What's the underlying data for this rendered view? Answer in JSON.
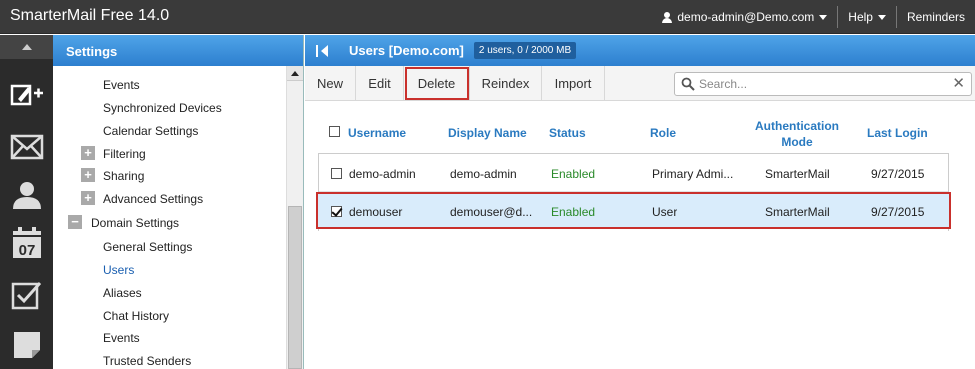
{
  "app": {
    "title": "SmarterMail Free 14.0"
  },
  "topbar": {
    "user": "demo-admin@Demo.com",
    "help": "Help",
    "reminders": "Reminders"
  },
  "rail": {
    "icons": [
      "compose-icon",
      "mail-icon",
      "contacts-icon",
      "calendar-icon",
      "tasks-icon",
      "notes-icon"
    ],
    "calendar_day": "07"
  },
  "settings": {
    "title": "Settings",
    "tree": [
      {
        "label": "Events",
        "indent": 2
      },
      {
        "label": "Synchronized Devices",
        "indent": 2
      },
      {
        "label": "Calendar Settings",
        "indent": 2
      },
      {
        "label": "Filtering",
        "indent": 1,
        "toggle": "+"
      },
      {
        "label": "Sharing",
        "indent": 1,
        "toggle": "+"
      },
      {
        "label": "Advanced Settings",
        "indent": 1,
        "toggle": "+"
      },
      {
        "label": "Domain Settings",
        "indent": 0,
        "toggle": "−"
      },
      {
        "label": "General Settings",
        "indent": 2
      },
      {
        "label": "Users",
        "indent": 2,
        "selected": true
      },
      {
        "label": "Aliases",
        "indent": 2
      },
      {
        "label": "Chat History",
        "indent": 2
      },
      {
        "label": "Events",
        "indent": 2
      },
      {
        "label": "Trusted Senders",
        "indent": 2
      }
    ]
  },
  "main": {
    "title": "Users [Demo.com]",
    "badge": "2 users, 0 / 2000 MB",
    "toolbar": {
      "new": "New",
      "edit": "Edit",
      "delete": "Delete",
      "reindex": "Reindex",
      "import": "Import"
    },
    "search": {
      "placeholder": "Search...",
      "value": ""
    },
    "columns": {
      "username": "Username",
      "display_name": "Display Name",
      "status": "Status",
      "role": "Role",
      "auth_mode_1": "Authentication",
      "auth_mode_2": "Mode",
      "last_login": "Last Login"
    },
    "rows": [
      {
        "username": "demo-admin",
        "display_name": "demo-admin",
        "status": "Enabled",
        "role": "Primary Admi...",
        "auth": "SmarterMail",
        "last_login": "9/27/2015",
        "checked": false
      },
      {
        "username": "demouser",
        "display_name": "demouser@d...",
        "status": "Enabled",
        "role": "User",
        "auth": "SmarterMail",
        "last_login": "9/27/2015",
        "checked": true
      }
    ]
  },
  "colors": {
    "header_blue": "#2d7fcf",
    "link_blue": "#2a7ac0",
    "enabled_green": "#2a8a2a",
    "highlight_red": "#c9302c",
    "selected_row": "#d9ecfb"
  }
}
